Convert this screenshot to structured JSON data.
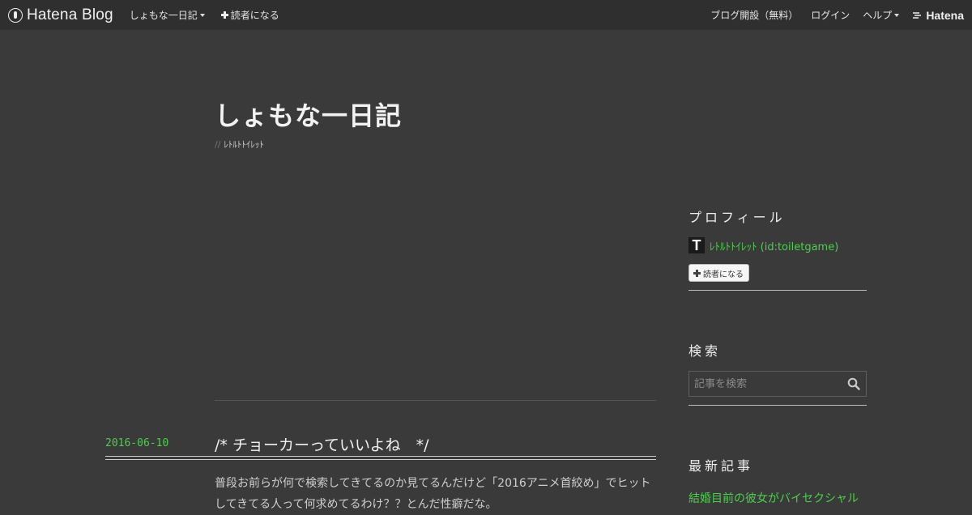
{
  "topbar": {
    "brand": "Hatena Blog",
    "blog_menu": "しょもな一日記",
    "subscribe": "読者になる",
    "open_blog": "ブログ開設（無料）",
    "login": "ログイン",
    "help": "ヘルプ",
    "hatena": "Hatena"
  },
  "header": {
    "title": "しょもな一日記",
    "subtitle_prefix": "//",
    "subtitle": "ﾚﾄﾙﾄﾄｲﾚｯﾄ"
  },
  "entry": {
    "date": "2016-06-10",
    "title": "/* チョーカーっていいよね　*/",
    "body": "普段お前らが何で検索してきてるのか見てるんだけど「2016アニメ首絞め」でヒットしてきてる人って何求めてるわけ？？とんだ性癖だな。"
  },
  "sidebar": {
    "profile_heading": "プロフィール",
    "avatar_letter": "T",
    "profile_name": "ﾚﾄﾙﾄﾄｲﾚｯﾄ (id:toiletgame)",
    "subscribe_button": "読者になる",
    "search_heading": "検索",
    "search_placeholder": "記事を検索",
    "recent_heading": "最新記事",
    "recent_items": [
      "結婚目前の彼女がバイセクシャル"
    ]
  },
  "colors": {
    "background": "#3a3a3a",
    "topbar": "#2f2f2f",
    "accent_green": "#4ccf4c"
  }
}
